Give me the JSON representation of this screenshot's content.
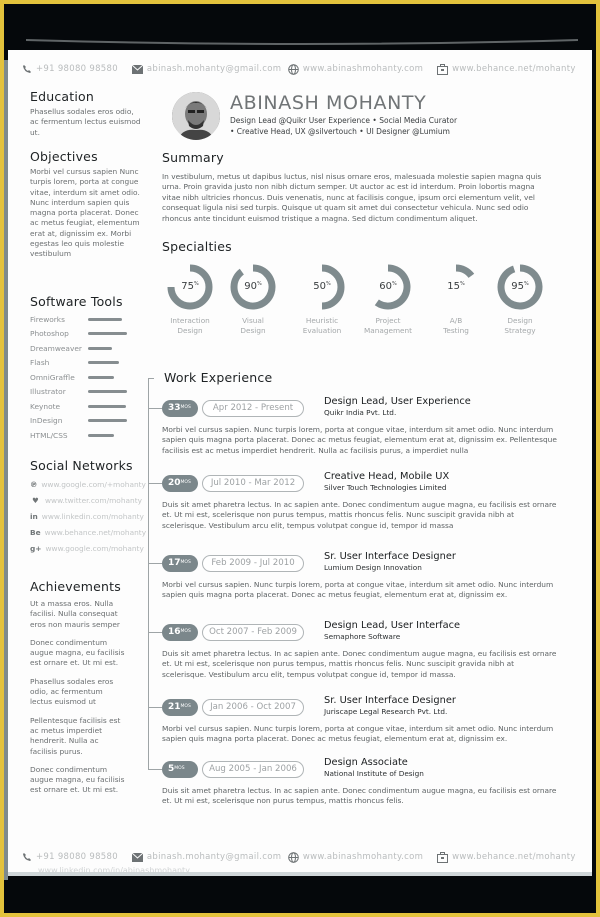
{
  "contacts": {
    "phone": "+91 98080 98580",
    "email": "abinash.mohanty@gmail.com",
    "website": "www.abinashmohanty.com",
    "portfolio": "www.behance.net/mohanty"
  },
  "footer_extra": "www.linkedin.com/in/abinashmohanty",
  "profile": {
    "name": "ABINASH MOHANTY",
    "tagline_1": "Design Lead @Quikr User Experience • Social Media Curator",
    "tagline_2": "• Creative Head, UX @silvertouch • UI Designer @Lumium"
  },
  "education": {
    "heading": "Education",
    "text": "Phasellus sodales eros odio, ac fermentum lectus euismod ut."
  },
  "objectives": {
    "heading": "Objectives",
    "text": "Morbi vel cursus sapien Nunc turpis lorem, porta at congue vitae, interdum sit amet odio. Nunc interdum sapien quis magna porta placerat. Donec ac metus feugiat, elementum erat at, dignissim ex. Morbi egestas leo quis molestie vestibulum"
  },
  "software_tools": {
    "heading": "Software Tools",
    "items": [
      {
        "name": "Fireworks",
        "level": 0.7
      },
      {
        "name": "Photoshop",
        "level": 0.82
      },
      {
        "name": "Dreamweaver",
        "level": 0.5
      },
      {
        "name": "Flash",
        "level": 0.64
      },
      {
        "name": "OmniGraffle",
        "level": 0.55
      },
      {
        "name": "Illustrator",
        "level": 0.82
      },
      {
        "name": "Keynote",
        "level": 0.8
      },
      {
        "name": "InDesign",
        "level": 0.82
      },
      {
        "name": "HTML/CSS",
        "level": 0.54
      }
    ]
  },
  "social": {
    "heading": "Social Networks",
    "items": [
      {
        "icon": "pinterest-icon",
        "glyph": "℗",
        "url": "www.google.com/+mohanty"
      },
      {
        "icon": "twitter-icon",
        "glyph": "♥",
        "url": "www.twitter.com/mohanty"
      },
      {
        "icon": "linkedin-icon",
        "glyph": "in",
        "url": "www.linkedin.com/mohanty"
      },
      {
        "icon": "behance-icon",
        "glyph": "Be",
        "url": "www.behance.net/mohanty"
      },
      {
        "icon": "googleplus-icon",
        "glyph": "g+",
        "url": "www.google.com/mohanty"
      }
    ]
  },
  "achievements": {
    "heading": "Achievements",
    "items": [
      "Ut a massa eros. Nulla facilisi. Nulla consequat eros non mauris semper",
      "Donec condimentum augue magna, eu facilisis est ornare et. Ut mi est.",
      "Phasellus sodales eros odio, ac fermentum lectus euismod ut",
      "Pellentesque facilisis est ac metus imperdiet hendrerit. Nulla ac facilisis purus.",
      "Donec condimentum augue magna, eu facilisis est ornare et. Ut mi est."
    ]
  },
  "summary": {
    "heading": "Summary",
    "text": "In vestibulum, metus ut dapibus luctus, nisl nisus ornare eros, malesuada molestie sapien magna quis urna. Proin gravida justo non nibh dictum semper. Ut auctor ac est id interdum. Proin lobortis magna vitae nibh ultricies rhoncus. Duis venenatis, nunc at facilisis congue, ipsum orci elementum velit, vel consequat ligula nisi sed turpis. Quisque ut quam sit amet dui consectetur vehicula. Nunc sed odio rhoncus ante tincidunt euismod tristique a magna. Sed dictum condimentum aliquet."
  },
  "specialties": {
    "heading": "Specialties",
    "percent_suffix": "%",
    "color": "#7f8b8e",
    "items": [
      {
        "label_1": "Interaction",
        "label_2": "Design",
        "value": 75
      },
      {
        "label_1": "Visual",
        "label_2": "Design",
        "value": 90
      },
      {
        "label_1": "Heuristic",
        "label_2": "Evaluation",
        "value": 50
      },
      {
        "label_1": "Project",
        "label_2": "Management",
        "value": 60
      },
      {
        "label_1": "A/B",
        "label_2": "Testing",
        "value": 15
      },
      {
        "label_1": "Design",
        "label_2": "Strategy",
        "value": 95
      }
    ]
  },
  "work": {
    "heading": "Work Experience",
    "months_unit": "MOS",
    "jobs": [
      {
        "months": "33",
        "dates": "Apr 2012 - Present",
        "title": "Design Lead, User Experience",
        "company": "Quikr India Pvt. Ltd.",
        "desc": "Morbi vel cursus sapien. Nunc turpis lorem, porta at congue vitae, interdum sit amet odio. Nunc interdum sapien quis magna porta placerat. Donec ac metus feugiat, elementum erat at, dignissim ex. Pellentesque facilisis est ac metus imperdiet hendrerit. Nulla ac facilisis purus, a imperdiet nulla"
      },
      {
        "months": "20",
        "dates": "Jul 2010 - Mar 2012",
        "title": "Creative Head, Mobile UX",
        "company": "Silver Touch Technologies Limited",
        "desc": "Duis sit amet pharetra lectus. In ac sapien ante. Donec condimentum augue magna, eu facilisis est ornare et. Ut mi est, scelerisque non purus tempus, mattis rhoncus felis. Nunc suscipit gravida nibh at scelerisque. Vestibulum arcu elit, tempus volutpat congue id, tempor id massa"
      },
      {
        "months": "17",
        "dates": "Feb 2009 - Jul 2010",
        "title": "Sr. User Interface Designer",
        "company": "Lumium Design Innovation",
        "desc": "Morbi vel cursus sapien. Nunc turpis lorem, porta at congue vitae, interdum sit amet odio. Nunc interdum sapien quis magna porta placerat. Donec ac metus feugiat, elementum erat at, dignissim ex."
      },
      {
        "months": "16",
        "dates": "Oct 2007 - Feb 2009",
        "title": "Design Lead, User Interface",
        "company": "Semaphore Software",
        "desc": "Duis sit amet pharetra lectus. In ac sapien ante. Donec condimentum augue magna, eu facilisis est ornare et. Ut mi est, scelerisque non purus tempus, mattis rhoncus felis. Nunc suscipit gravida nibh at scelerisque. Vestibulum arcu elit, tempus volutpat congue id, tempor id massa."
      },
      {
        "months": "21",
        "dates": "Jan 2006 - Oct 2007",
        "title": "Sr. User Interface Designer",
        "company": "Juriscape Legal Research Pvt. Ltd.",
        "desc": "Morbi vel cursus sapien. Nunc turpis lorem, porta at congue vitae, interdum sit amet odio. Nunc interdum sapien quis magna porta placerat. Donec ac metus feugiat, elementum erat at, dignissim ex."
      },
      {
        "months": "5",
        "dates": "Aug 2005 - Jan 2006",
        "title": "Design Associate",
        "company": "National Institute of Design",
        "desc": "Duis sit amet pharetra lectus. In ac sapien ante. Donec condimentum augue magna, eu facilisis est ornare et. Ut mi est, scelerisque non purus tempus, mattis rhoncus felis."
      }
    ]
  }
}
